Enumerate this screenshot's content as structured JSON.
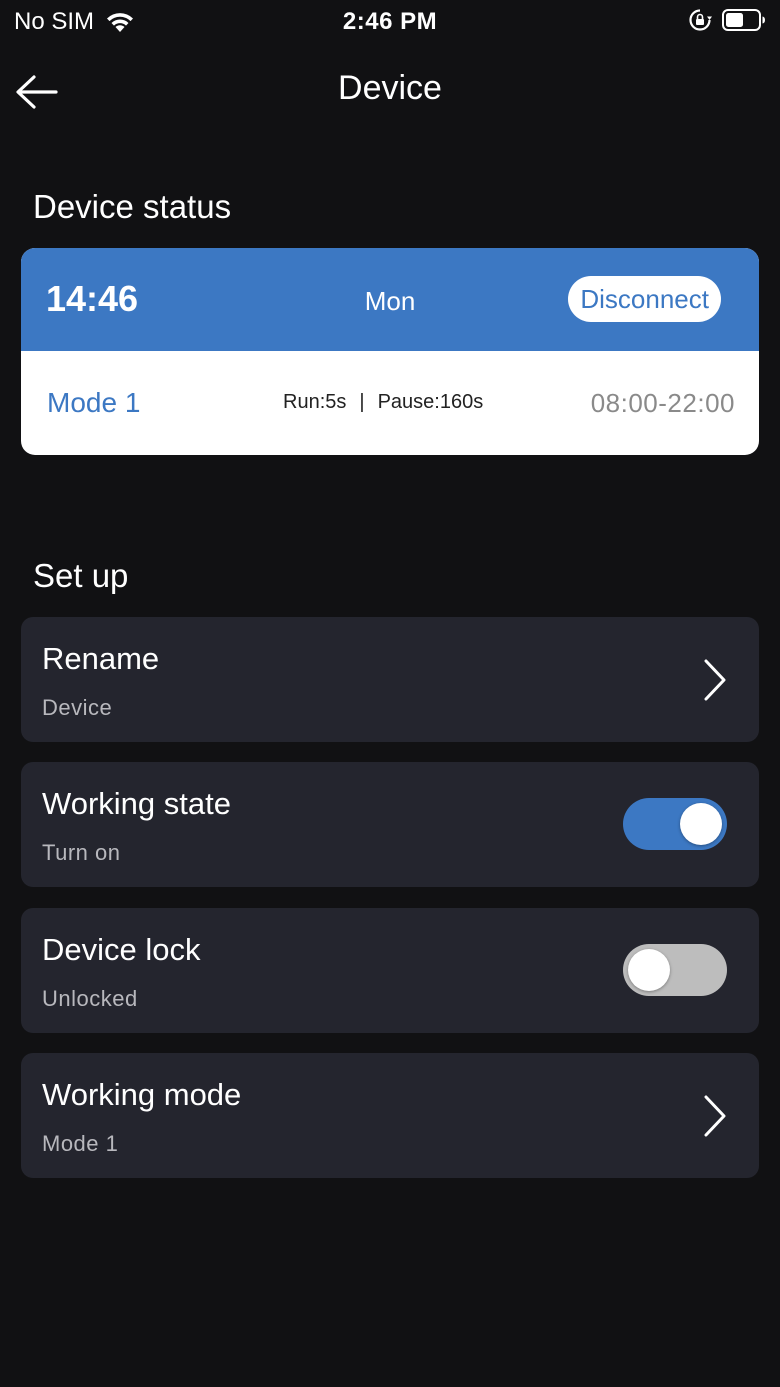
{
  "status_bar": {
    "carrier": "No SIM",
    "time": "2:46 PM",
    "icons": [
      "wifi-icon",
      "orientation-lock-icon",
      "battery-icon"
    ]
  },
  "nav": {
    "title": "Device",
    "back_icon": "arrow-left-icon"
  },
  "device_status": {
    "section_title": "Device status",
    "time": "14:46",
    "day": "Mon",
    "disconnect_label": "Disconnect",
    "mode": "Mode 1",
    "run": "Run:5s",
    "separator": "|",
    "pause": "Pause:160s",
    "time_range": "08:00-22:00",
    "accent_color": "#3c78c3"
  },
  "setup": {
    "section_title": "Set up",
    "rows": [
      {
        "title": "Rename",
        "subtitle": "Device",
        "control": "chevron-right-icon"
      },
      {
        "title": "Working state",
        "subtitle": "Turn on",
        "control": "toggle",
        "toggle_on": true
      },
      {
        "title": "Device lock",
        "subtitle": "Unlocked",
        "control": "toggle",
        "toggle_on": false
      },
      {
        "title": "Working mode",
        "subtitle": "Mode 1",
        "control": "chevron-right-icon"
      }
    ]
  }
}
